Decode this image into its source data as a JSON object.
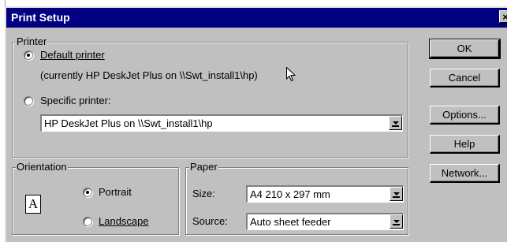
{
  "dialog": {
    "title": "Print Setup",
    "close_glyph": "×"
  },
  "printer": {
    "group_label": "Printer",
    "default_label": "Default printer",
    "default_selected": true,
    "current_printer_text": "(currently HP DeskJet Plus on \\\\Swt_install1\\hp)",
    "specific_label": "Specific printer:",
    "specific_selected": false,
    "specific_value": "HP DeskJet Plus on \\\\Swt_install1\\hp"
  },
  "orientation": {
    "group_label": "Orientation",
    "icon_letter": "A",
    "portrait_label": "Portrait",
    "portrait_selected": true,
    "landscape_label": "Landscape",
    "landscape_selected": false
  },
  "paper": {
    "group_label": "Paper",
    "size_label": "Size:",
    "size_value": "A4 210 x 297 mm",
    "source_label": "Source:",
    "source_value": "Auto sheet feeder"
  },
  "buttons": {
    "ok": "OK",
    "cancel": "Cancel",
    "options": "Options...",
    "help": "Help",
    "network": "Network..."
  },
  "colors": {
    "title_bar": "#000080",
    "face": "#c0c0c0"
  }
}
